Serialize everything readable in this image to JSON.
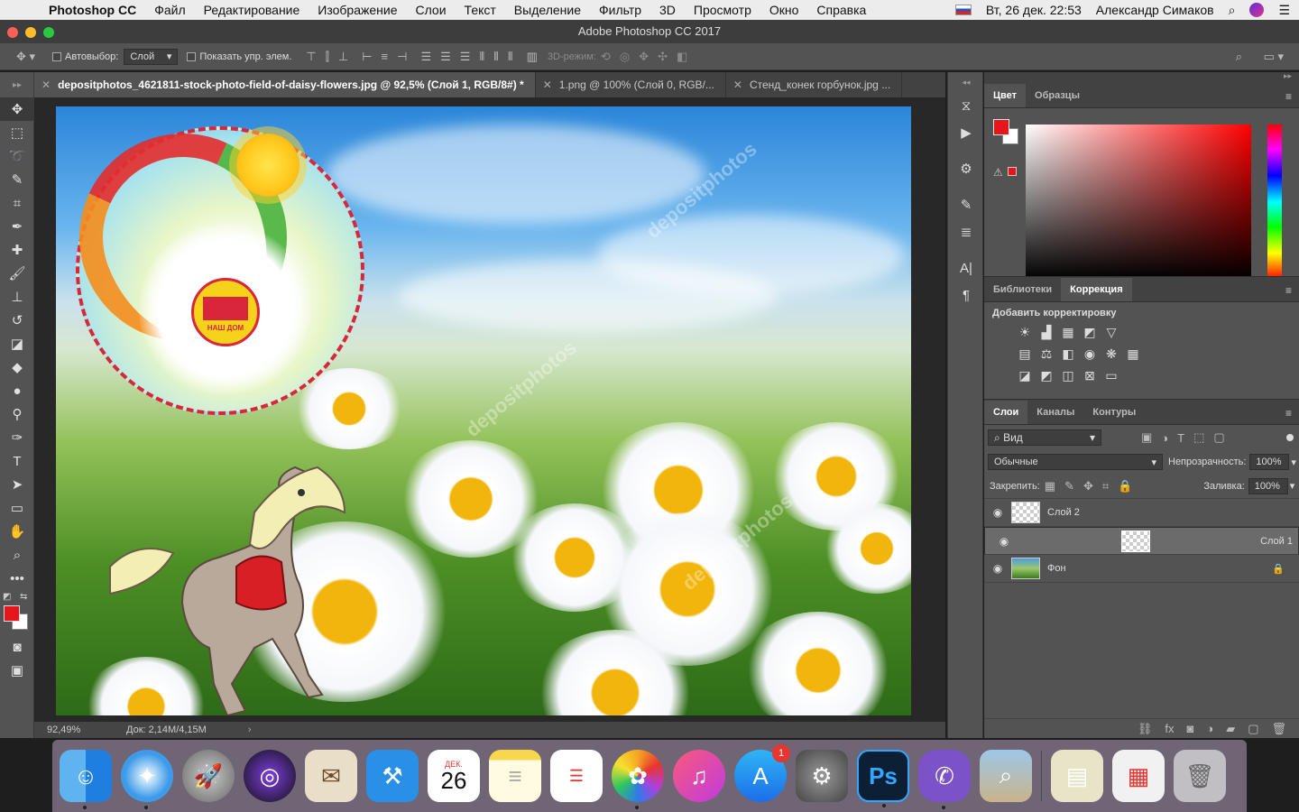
{
  "menubar": {
    "app_name": "Photoshop CC",
    "items": [
      "Файл",
      "Редактирование",
      "Изображение",
      "Слои",
      "Текст",
      "Выделение",
      "Фильтр",
      "3D",
      "Просмотр",
      "Окно",
      "Справка"
    ],
    "input_lang": "Вт",
    "datetime": "Вт, 26 дек. 22:53",
    "user": "Александр Симаков"
  },
  "window": {
    "title": "Adobe Photoshop CC 2017"
  },
  "options": {
    "autoselect_label": "Автовыбор:",
    "autoselect_value": "Слой",
    "show_transform_label": "Показать упр. элем.",
    "mode3d_label": "3D-режим:"
  },
  "tabs": [
    {
      "label": "depositphotos_4621811-stock-photo-field-of-daisy-flowers.jpg @ 92,5% (Слой 1, RGB/8#) *",
      "active": true
    },
    {
      "label": "1.png @ 100% (Слой 0, RGB/...",
      "active": false
    },
    {
      "label": "Стенд_конек горбунок.jpg ...",
      "active": false
    }
  ],
  "status": {
    "zoom": "92,49%",
    "doc": "Док: 2,14M/4,15M"
  },
  "canvas": {
    "watermark": "depositphotos",
    "logo_text": "НАШ ДОМ"
  },
  "color_panel": {
    "tabs": [
      "Цвет",
      "Образцы"
    ],
    "fg_color": "#e8151b",
    "bg_color": "#ffffff"
  },
  "adjust_panel": {
    "tabs": [
      "Библиотеки",
      "Коррекция"
    ],
    "heading": "Добавить корректировку"
  },
  "layers_panel": {
    "tabs": [
      "Слои",
      "Каналы",
      "Контуры"
    ],
    "filter_label": "Вид",
    "blend_mode": "Обычные",
    "opacity_label": "Непрозрачность:",
    "opacity_value": "100%",
    "lock_label": "Закрепить:",
    "fill_label": "Заливка:",
    "fill_value": "100%",
    "layers": [
      {
        "name": "Слой 2",
        "selected": false
      },
      {
        "name": "Слой 1",
        "selected": true
      },
      {
        "name": "Фон",
        "selected": false
      }
    ]
  },
  "dock": {
    "calendar_month": "ДЕК.",
    "calendar_day": "26",
    "appstore_badge": "1",
    "photoshop_label": "Ps"
  }
}
